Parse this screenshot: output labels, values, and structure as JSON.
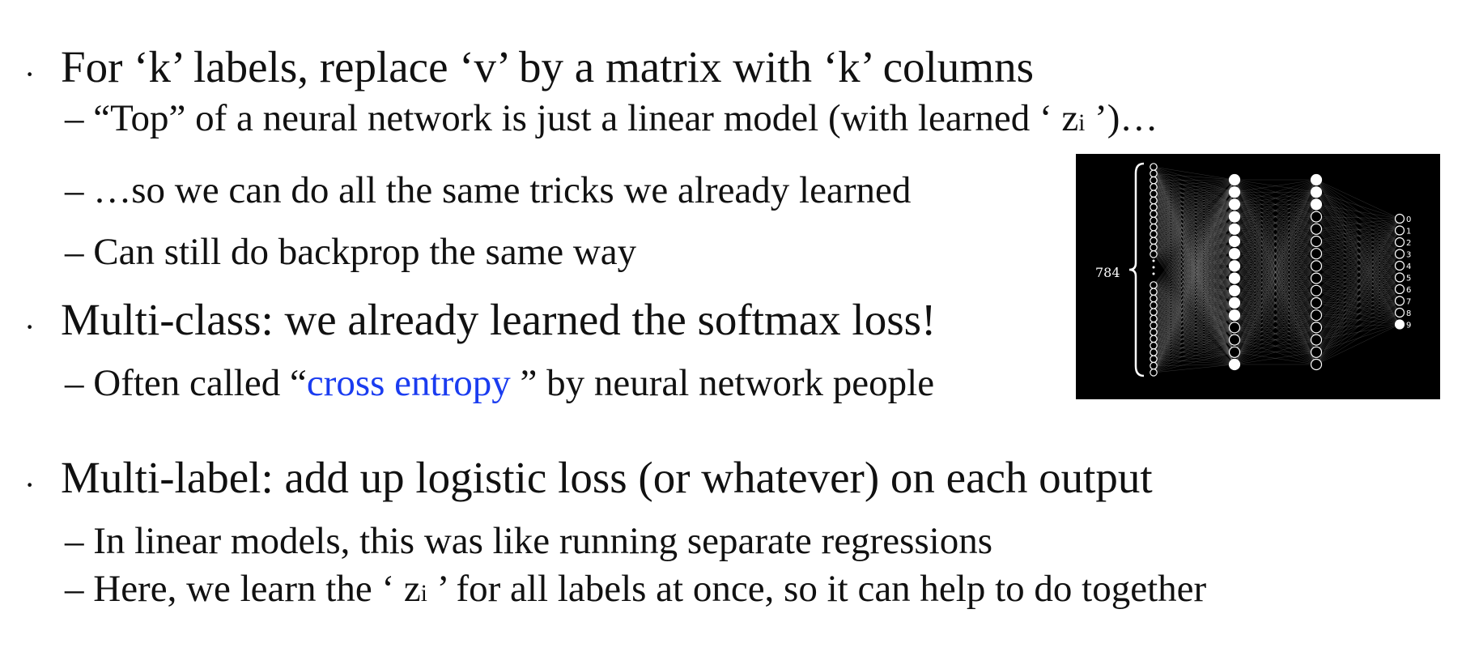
{
  "slide": {
    "bullet_char": "·",
    "items": [
      {
        "text": "For ‘k’ labels, replace ‘v’ by a matrix with ‘k’ columns",
        "subitems": [
          {
            "dash": "–",
            "pre": "“Top” of a neural network is just a linear model (with learned ‘ ",
            "z": "z",
            "sub": "i",
            "post": " ’)…"
          },
          {
            "dash": "–",
            "text": "…so we can do all the same tricks we already learned"
          },
          {
            "dash": "–",
            "text": "Can still do backprop the same way"
          }
        ]
      },
      {
        "text": "Multi-class: we already learned the softmax loss!",
        "subitems": [
          {
            "dash": "–",
            "pre": "Often called “",
            "link": "cross entropy",
            "post": " ” by neural network people"
          }
        ]
      },
      {
        "text": "Multi-label: add up logistic loss (or whatever) on each output",
        "subitems": [
          {
            "dash": "–",
            "text": "In linear models, this was like running separate regressions"
          },
          {
            "dash": "–",
            "pre": "Here, we learn the ‘ ",
            "z": "z",
            "sub": "i",
            "post": " ’ for all labels at once, so it can help to do together"
          }
        ]
      }
    ],
    "figure": {
      "input_count_label": "784",
      "output_labels": [
        "0",
        "1",
        "2",
        "3",
        "4",
        "5",
        "6",
        "7",
        "8",
        "9"
      ]
    }
  },
  "colors": {
    "text": "#111111",
    "link": "#1a3cf0",
    "figure_bg": "#000000"
  }
}
